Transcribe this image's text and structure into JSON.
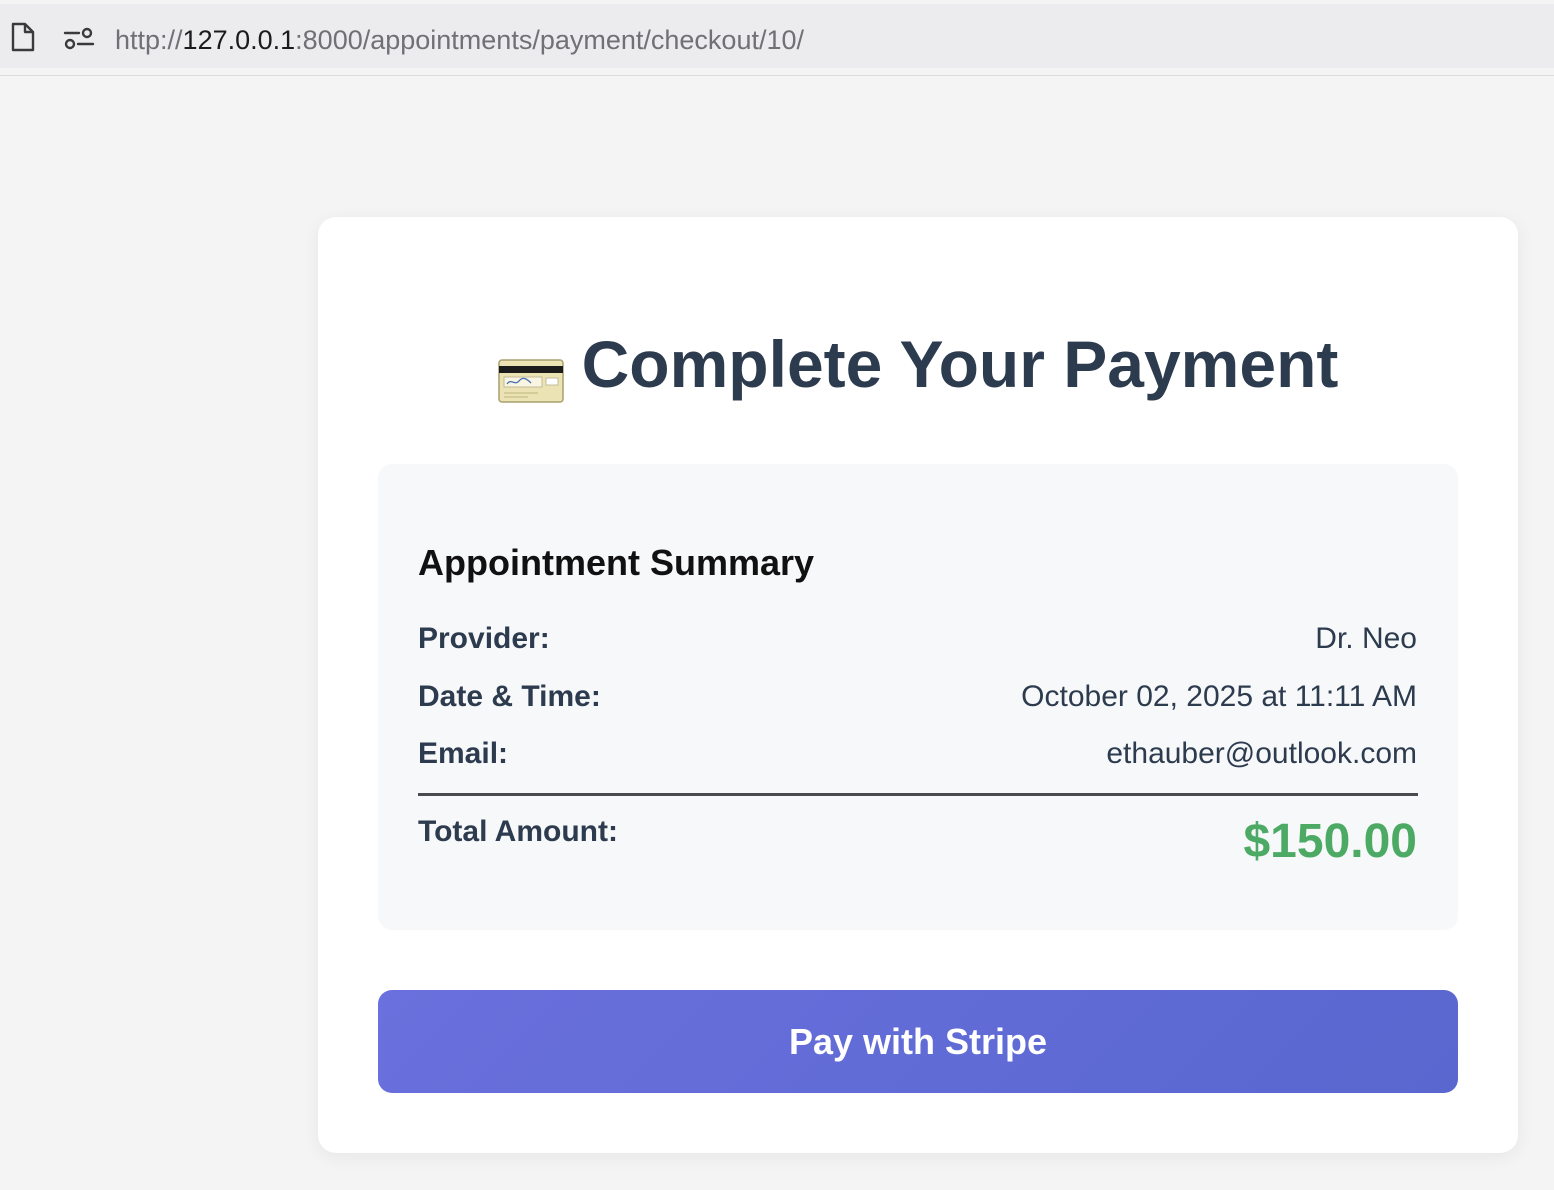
{
  "browser": {
    "url_scheme": "http://",
    "url_host": "127.0.0.1",
    "url_rest": ":8000/appointments/payment/checkout/10/",
    "page_icon": "document-icon",
    "settings_icon": "site-settings-icon"
  },
  "page": {
    "title_icon": "credit-card-icon",
    "title": "Complete Your Payment"
  },
  "summary": {
    "heading": "Appointment Summary",
    "rows": [
      {
        "label": "Provider:",
        "value": "Dr. Neo"
      },
      {
        "label": "Date & Time:",
        "value": "October 02, 2025 at 11:11 AM"
      },
      {
        "label": "Email:",
        "value": "ethauber@outlook.com"
      }
    ],
    "total_label": "Total Amount:",
    "total_value": "$150.00"
  },
  "actions": {
    "pay_label": "Pay with Stripe"
  },
  "colors": {
    "background": "#f4f4f5",
    "title": "#2d3b4e",
    "total": "#4caa64",
    "button_start": "#6a70dd",
    "button_end": "#5967cf"
  }
}
